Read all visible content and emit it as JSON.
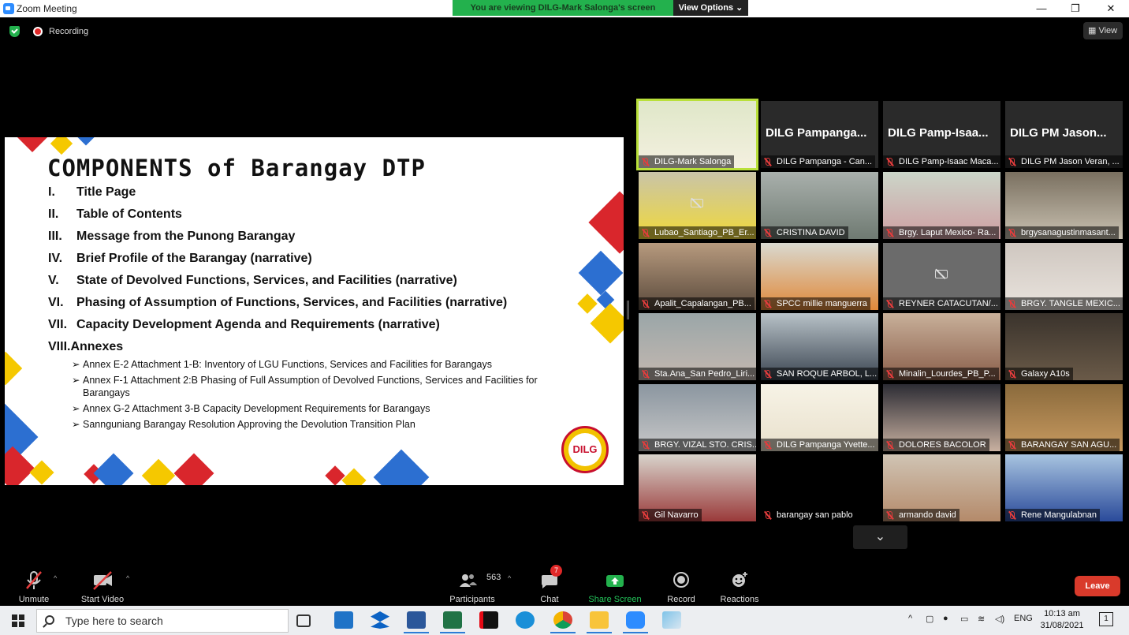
{
  "window": {
    "title": "Zoom Meeting",
    "minimize": "—",
    "maximize": "❐",
    "close": "✕"
  },
  "banner": {
    "viewing": "You are viewing DILG-Mark Salonga's screen",
    "view_options": "View Options ⌄"
  },
  "status": {
    "recording": "Recording",
    "view_button": "▦ View"
  },
  "slide": {
    "title": "COMPONENTS of Barangay DTP",
    "items": [
      {
        "num": "I.",
        "text": "Title Page"
      },
      {
        "num": "II.",
        "text": "Table of Contents"
      },
      {
        "num": "III.",
        "text": "Message from the Punong Barangay"
      },
      {
        "num": "IV.",
        "text": "Brief Profile of the Barangay (narrative)"
      },
      {
        "num": "V.",
        "text": "State of Devolved Functions, Services, and Facilities (narrative)"
      },
      {
        "num": "VI.",
        "text": "Phasing of Assumption of Functions, Services, and Facilities (narrative)"
      },
      {
        "num": "VII.",
        "text": "Capacity Development Agenda and Requirements (narrative)"
      }
    ],
    "annex_heading": "VIII.Annexes",
    "annexes": [
      "Annex E-2 Attachment 1-B: Inventory of LGU Functions, Services and Facilities for Barangays",
      "Annex F-1 Attachment 2:B Phasing of Full Assumption of Devolved Functions, Services and Facilities for Barangays",
      "Annex G-2 Attachment 3-B Capacity Development Requirements for Barangays",
      "Sannguniang Barangay Resolution Approving the Devolution Transition Plan"
    ],
    "logo_text": "DILG",
    "colors": {
      "red": "#d9262c",
      "blue": "#2c6fd1",
      "yellow": "#f5c800"
    }
  },
  "gallery": [
    {
      "name": "DILG-Mark Salonga",
      "big": "",
      "active": true
    },
    {
      "name": "DILG Pampanga - Can...",
      "big": "DILG Pampanga..."
    },
    {
      "name": "DILG Pamp-Isaac Maca...",
      "big": "DILG Pamp-Isaa..."
    },
    {
      "name": "DILG PM Jason Veran, ...",
      "big": "DILG PM Jason..."
    },
    {
      "name": "Lubao_Santiago_PB_Er..."
    },
    {
      "name": "CRISTINA DAVID"
    },
    {
      "name": "Brgy. Laput Mexico- Ra..."
    },
    {
      "name": "brgysanagustinmasant..."
    },
    {
      "name": "Apalit_Capalangan_PB..."
    },
    {
      "name": "SPCC millie manguerra"
    },
    {
      "name": "REYNER CATACUTAN/..."
    },
    {
      "name": "BRGY. TANGLE MEXIC..."
    },
    {
      "name": "Sta.Ana_San Pedro_Liri..."
    },
    {
      "name": "SAN ROQUE ARBOL, L..."
    },
    {
      "name": "Minalin_Lourdes_PB_P..."
    },
    {
      "name": "Galaxy A10s"
    },
    {
      "name": "BRGY. VIZAL STO. CRIS..."
    },
    {
      "name": "DILG Pampanga Yvette..."
    },
    {
      "name": "DOLORES BACOLOR"
    },
    {
      "name": "BARANGAY SAN AGU..."
    },
    {
      "name": "Gil Navarro"
    },
    {
      "name": "barangay san pablo"
    },
    {
      "name": "armando david"
    },
    {
      "name": "Rene Mangulabnan"
    }
  ],
  "expand_icon": "⌄",
  "toolbar": {
    "unmute": "Unmute",
    "start_video": "Start Video",
    "participants": "Participants",
    "participant_count": "563",
    "chat": "Chat",
    "chat_badge": "7",
    "share_screen": "Share Screen",
    "record": "Record",
    "reactions": "Reactions",
    "leave": "Leave"
  },
  "taskbar": {
    "search_placeholder": "Type here to search",
    "language": "ENG",
    "time": "10:13 am",
    "date": "31/08/2021",
    "notification_count": "1"
  }
}
